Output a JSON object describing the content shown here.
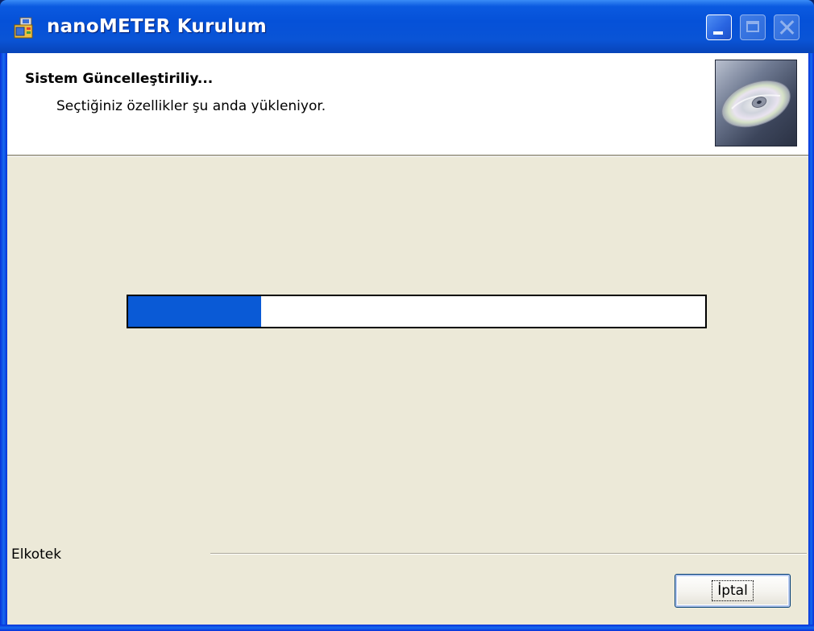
{
  "window": {
    "title": "nanoMETER Kurulum",
    "icon": "installer-icon"
  },
  "titlebar_buttons": {
    "minimize": "minimize-icon",
    "maximize": "maximize-icon",
    "close": "close-icon"
  },
  "header": {
    "title": "Sistem Güncelleştiriliy...",
    "subtitle": "Seçtiğiniz özellikler şu anda yükleniyor.",
    "image": "cd-disc-icon"
  },
  "progress": {
    "value_percent": 23,
    "fill_color": "#0a5ad6"
  },
  "footer": {
    "brand": "Elkotek",
    "cancel_label": "İptal"
  },
  "colors": {
    "titlebar": "#0551d8",
    "dialog_bg": "#ece9d8",
    "header_bg": "#ffffff"
  }
}
